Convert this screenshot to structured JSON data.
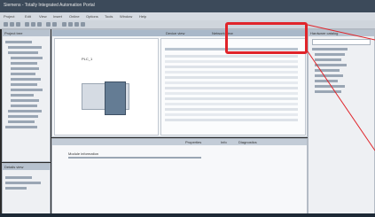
{
  "app": {
    "title": "Siemens - Totally Integrated Automation Portal"
  },
  "menu": {
    "items": [
      "Project",
      "Edit",
      "View",
      "Insert",
      "Online",
      "Options",
      "Tools",
      "Window",
      "Help"
    ]
  },
  "project_tree": {
    "title": "Project tree"
  },
  "details_view": {
    "title": "Details view"
  },
  "editor": {
    "tabs": [
      "Device view",
      "Network view"
    ],
    "device_label": "PLC_1"
  },
  "inspector": {
    "tabs": [
      "Properties",
      "Info",
      "Diagnostics"
    ],
    "info_line": "Module information"
  },
  "right_pane": {
    "title": "Hardware catalog"
  },
  "colors": {
    "highlight": "#e0242a",
    "titlebar": "#3c4a5a"
  }
}
